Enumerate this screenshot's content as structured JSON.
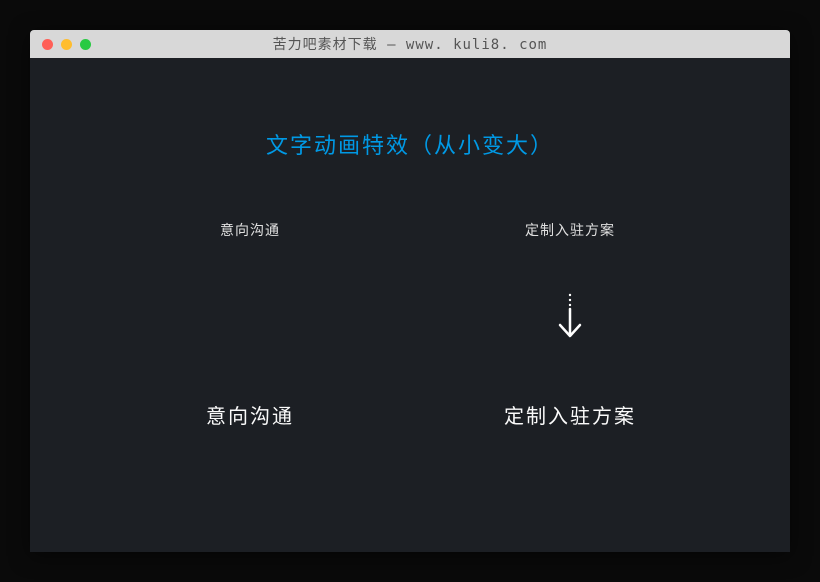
{
  "window": {
    "title": "苦力吧素材下载 — www. kuli8. com"
  },
  "heading": "文字动画特效（从小变大）",
  "columns": {
    "left": {
      "small": "意向沟通",
      "large": "意向沟通"
    },
    "right": {
      "small": "定制入驻方案",
      "large": "定制入驻方案"
    }
  },
  "icons": {
    "arrow_down": "arrow-down"
  }
}
